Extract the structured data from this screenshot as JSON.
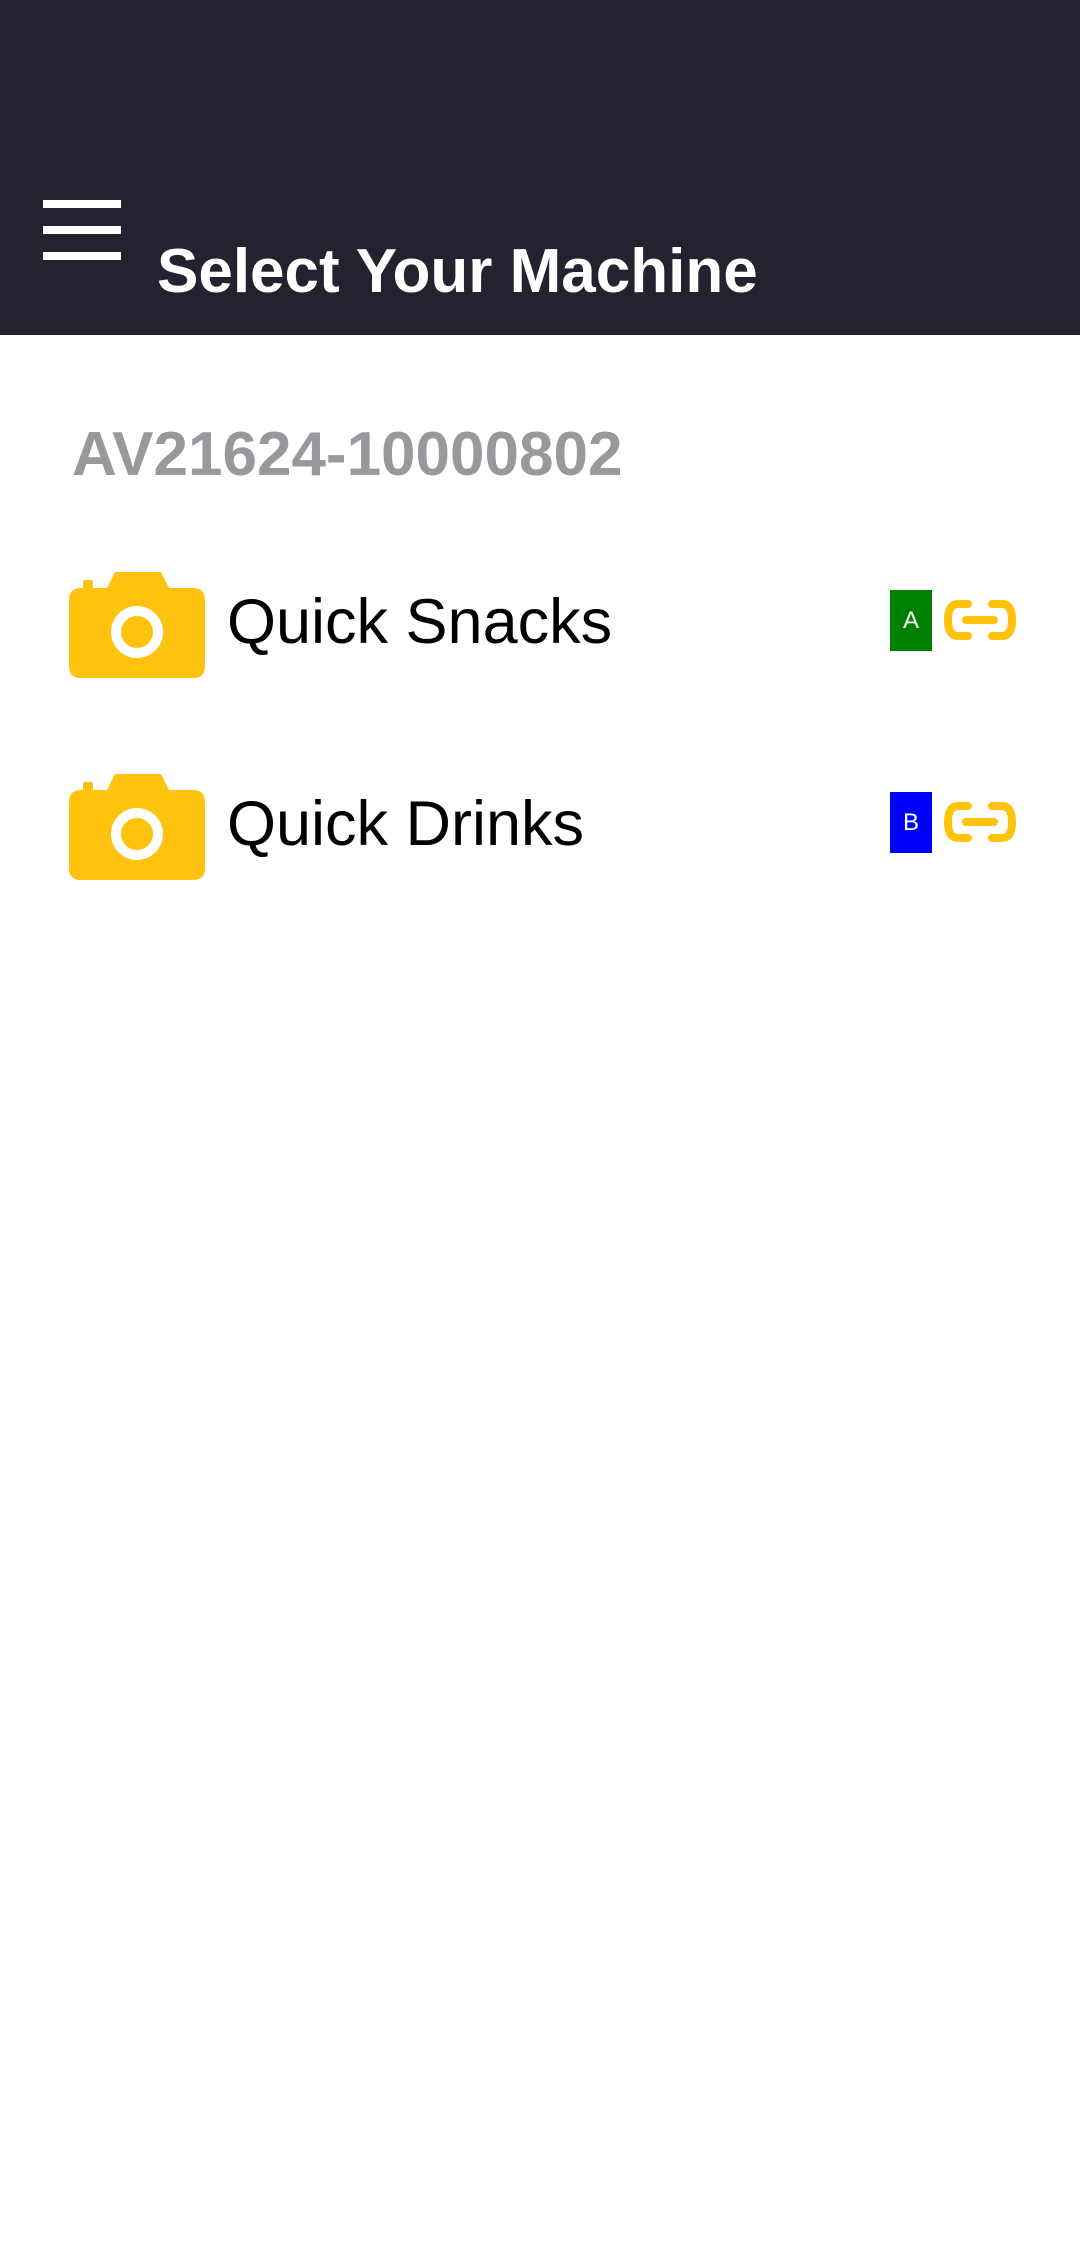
{
  "header": {
    "title": "Select Your Machine",
    "menu_icon": "hamburger-menu-icon",
    "background": "#23222f"
  },
  "machine": {
    "id": "AV21624-10000802"
  },
  "machines": [
    {
      "label": "Quick Snacks",
      "slot": "A",
      "slot_color": "#008000",
      "icon": "camera-icon",
      "action_icon": "link-icon"
    },
    {
      "label": "Quick Drinks",
      "slot": "B",
      "slot_color": "#0000ff",
      "icon": "camera-icon",
      "action_icon": "link-icon"
    }
  ],
  "colors": {
    "accent": "#ffc20e",
    "machine_id_text": "#98989d"
  }
}
